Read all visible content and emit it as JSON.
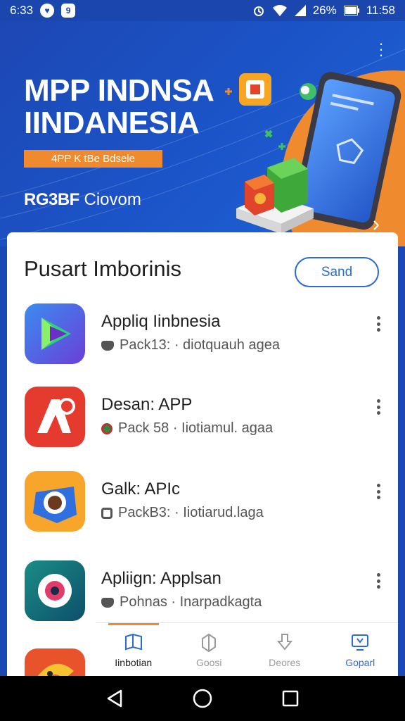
{
  "status_bar": {
    "time": "6:33",
    "battery": "26%",
    "clock": "11:58",
    "app_icons": [
      "notification-app-icon",
      "messenger-icon"
    ]
  },
  "hero": {
    "title_line1": "MPP INDNSA",
    "title_line2": "IINDANESIA",
    "tag": "4PP K tBe Bdsele",
    "brand_bold": "RG3BF",
    "brand_rest": "Ciovom"
  },
  "section": {
    "title": "Pusart Imborinis",
    "button_label": "Sand"
  },
  "apps": [
    {
      "name": "Appliq Iinbnesia",
      "meta": "Pack13: · diotquauh agea",
      "icon": "play-store-icon",
      "meta_icon": "cloud-icon"
    },
    {
      "name": "Desan: APP",
      "meta": "Pack 58 · Iiotiamul. agaa",
      "icon": "a-logo-icon",
      "meta_icon": "chrome-icon"
    },
    {
      "name": "Galk: APIc",
      "meta": "PackB3: · Iiotiarud.laga",
      "icon": "camera-icon",
      "meta_icon": "shield-icon"
    },
    {
      "name": "Apliign: Applsan",
      "meta": "Pohnas · Inarpadkagta",
      "icon": "lens-icon",
      "meta_icon": "cloud-icon"
    }
  ],
  "tabs": [
    {
      "label": "Iinbotian",
      "icon": "book-icon",
      "state": "active"
    },
    {
      "label": "Goosi",
      "icon": "box-icon",
      "state": "inactive"
    },
    {
      "label": "Deores",
      "icon": "download-icon",
      "state": "inactive"
    },
    {
      "label": "Goparl",
      "icon": "tv-icon",
      "state": "blue"
    }
  ],
  "colors": {
    "brand_blue": "#1d47b4",
    "accent_orange": "#f08a2e",
    "link_blue": "#2a6cd3"
  }
}
